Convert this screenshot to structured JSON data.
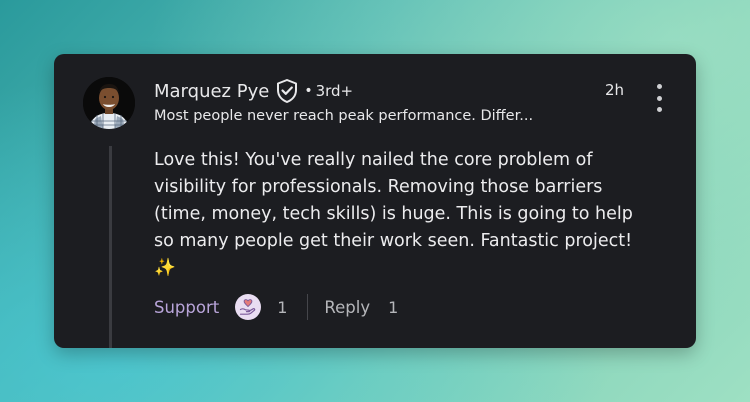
{
  "comment": {
    "author_name": "Marquez Pye",
    "verified_icon": "shield-check-icon",
    "connection_dot": "•",
    "connection_degree": "3rd+",
    "headline": "Most people never reach peak performance. Differ...",
    "timestamp": "2h",
    "body": "Love this! You've really nailed the core problem of visibility for professionals. Removing those barriers (time, money, tech skills) is huge. This is going to help so many people get their work seen. Fantastic project! ✨",
    "actions": {
      "support_label": "Support",
      "reaction_icon": "hand-heart-icon",
      "reaction_count": "1",
      "reply_label": "Reply",
      "reply_count": "1"
    }
  },
  "colors": {
    "card_bg": "#1c1d21",
    "support_accent": "#b9a5da",
    "text_primary": "#e8e8ea",
    "text_secondary": "#b5b6ba"
  }
}
